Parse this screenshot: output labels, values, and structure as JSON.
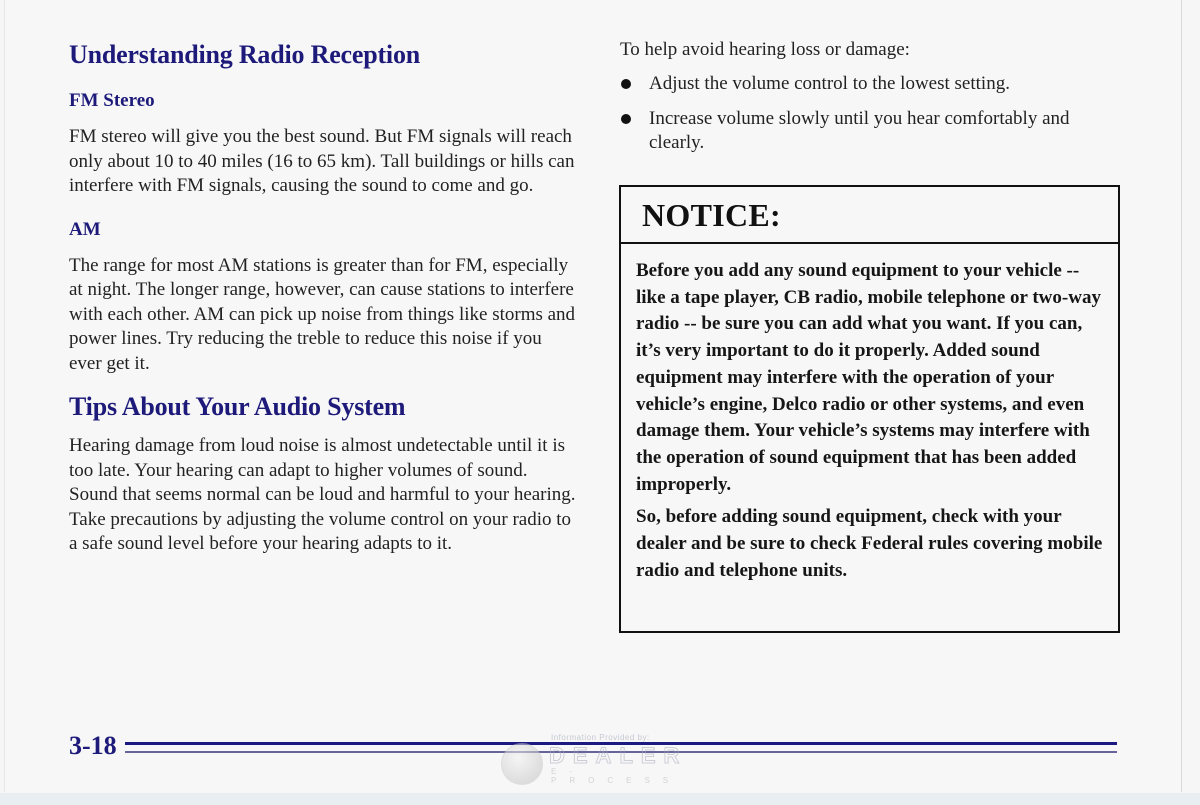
{
  "left_column": {
    "section_title": "Understanding Radio Reception",
    "fm": {
      "heading": "FM Stereo",
      "text": "FM stereo will give you the best sound. But FM signals will reach only about 10 to 40 miles (16 to 65 km). Tall buildings or hills can interfere with FM signals, causing the sound to come and go."
    },
    "am": {
      "heading": "AM",
      "text": "The range for most AM stations is greater than for FM, especially at night. The longer range, however, can cause stations to interfere with each other. AM can pick up noise from things like storms and power lines. Try reducing the treble to reduce this noise if you ever get it."
    },
    "tips": {
      "heading": "Tips About Your Audio System",
      "text": "Hearing damage from loud noise is almost undetectable until it is too late. Your hearing can adapt to higher volumes of sound. Sound that seems normal can be loud and harmful to your hearing. Take precautions by adjusting the volume control on your radio to a safe sound level before your hearing adapts to it."
    }
  },
  "right_column": {
    "intro": "To help avoid hearing loss or damage:",
    "bullets": [
      "Adjust the volume control to the lowest setting.",
      "Increase volume slowly until you hear comfortably and clearly."
    ],
    "notice": {
      "title": "NOTICE:",
      "paragraphs": [
        "Before you add any sound equipment to your vehicle -- like a tape player, CB radio, mobile telephone or two-way radio -- be sure you can add what you want. If you can, it’s very important to do it properly. Added sound equipment may interfere with the operation of your vehicle’s engine, Delco radio or other systems, and even damage them. Your vehicle’s systems may interfere with the operation of sound equipment that has been added improperly.",
        "So, before adding sound equipment, check with your dealer and be sure to check Federal rules covering mobile radio and telephone units."
      ]
    }
  },
  "footer": {
    "page_number": "3-18",
    "watermark": {
      "caption": "Information Provided by:",
      "brand": "DEALER",
      "sub": "E-PROCESS"
    }
  },
  "colors": {
    "heading_blue": "#1d1a7a",
    "rule_blue": "#1c1a80",
    "text": "#222222"
  }
}
